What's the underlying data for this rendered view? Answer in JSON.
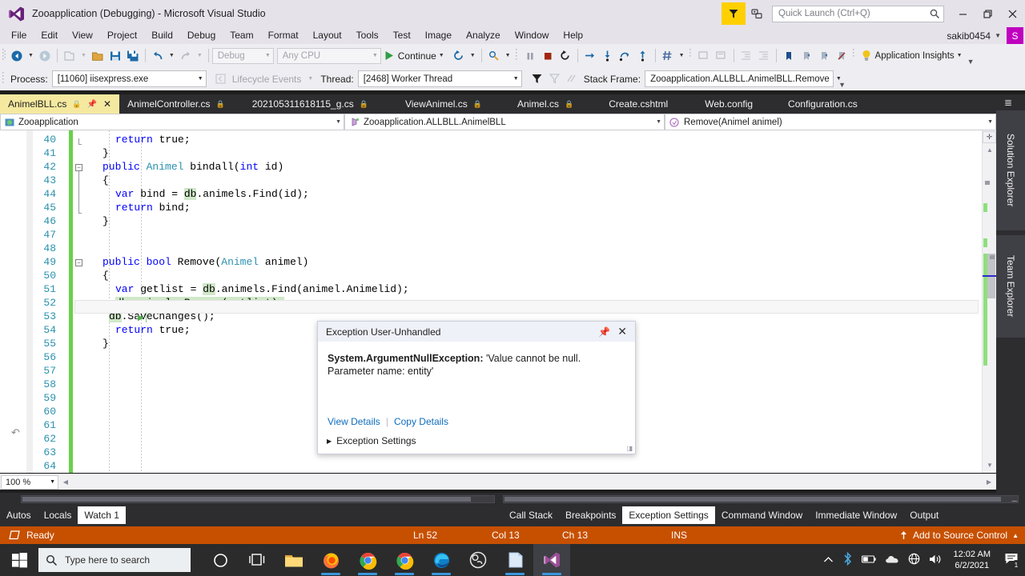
{
  "titlebar": {
    "title": "Zooapplication (Debugging) - Microsoft Visual Studio",
    "quick_launch_placeholder": "Quick Launch (Ctrl+Q)",
    "feedback_icon": "feedback-funnel-icon",
    "notify_icon": "notifications-icon",
    "search_icon": "search-icon",
    "minimize": "—",
    "restore": "❐",
    "close": "✕"
  },
  "menu": {
    "items": [
      "File",
      "Edit",
      "View",
      "Project",
      "Build",
      "Debug",
      "Team",
      "Format",
      "Layout",
      "Tools",
      "Test",
      "Image",
      "Analyze",
      "Window",
      "Help"
    ],
    "user_name": "sakib0454",
    "user_initial": "S"
  },
  "toolbar": {
    "config_value": "Debug",
    "platform_value": "Any CPU",
    "continue_label": "Continue",
    "app_insights_label": "Application Insights",
    "icons": {
      "navigate_back": "navigate-back-icon",
      "navigate_forward": "navigate-forward-icon",
      "new_project": "new-project-icon",
      "open_file": "open-file-icon",
      "save": "save-icon",
      "save_all": "save-all-icon",
      "undo": "undo-icon",
      "redo": "redo-icon",
      "attach": "attach-to-process-icon",
      "pause": "pause-icon",
      "stop": "stop-debugging-icon",
      "restart": "restart-icon",
      "show_next": "show-next-statement-icon",
      "step_into": "step-into-icon",
      "step_over": "step-over-icon",
      "step_out": "step-out-icon",
      "hash": "hash-icon",
      "bookmark": "bookmark-icon",
      "bulb": "lightbulb-icon"
    }
  },
  "debug_toolbar": {
    "process_label": "Process:",
    "process_value": "[11060] iisexpress.exe",
    "lifecycle_label": "Lifecycle Events",
    "thread_label": "Thread:",
    "thread_value": "[2468] Worker Thread",
    "stackframe_label": "Stack Frame:",
    "stackframe_value": "Zooapplication.ALLBLL.AnimelBLL.Remove",
    "filter_icon": "filter-icon"
  },
  "tabs": [
    {
      "label": "AnimelBLL.cs",
      "active": true,
      "locked": true,
      "pinnable": true,
      "closable": true
    },
    {
      "label": "AnimelController.cs",
      "active": false,
      "locked": true
    },
    {
      "label": "202105311618115_g.cs",
      "active": false,
      "locked": true
    },
    {
      "label": "ViewAnimel.cs",
      "active": false,
      "locked": true
    },
    {
      "label": "Animel.cs",
      "active": false,
      "locked": true
    },
    {
      "label": "Create.cshtml",
      "active": false,
      "locked": false
    },
    {
      "label": "Web.config",
      "active": false,
      "locked": false
    },
    {
      "label": "Configuration.cs",
      "active": false,
      "locked": false
    }
  ],
  "navbar": {
    "project": "Zooapplication",
    "type": "Zooapplication.ALLBLL.AnimelBLL",
    "member": "Remove(Animel animel)"
  },
  "editor": {
    "zoom": "100 %",
    "lines": [
      {
        "n": 40,
        "indent": 6,
        "tokens": [
          {
            "t": "return",
            "c": "kw"
          },
          {
            "t": " true;",
            "c": ""
          }
        ]
      },
      {
        "n": 41,
        "indent": 4,
        "tokens": [
          {
            "t": "}",
            "c": ""
          }
        ]
      },
      {
        "n": 42,
        "indent": 4,
        "tokens": [
          {
            "t": "public",
            "c": "kw"
          },
          {
            "t": " ",
            "c": ""
          },
          {
            "t": "Animel",
            "c": "ty"
          },
          {
            "t": " bindall(",
            "c": ""
          },
          {
            "t": "int",
            "c": "kw"
          },
          {
            "t": " id)",
            "c": ""
          }
        ]
      },
      {
        "n": 43,
        "indent": 4,
        "tokens": [
          {
            "t": "{",
            "c": ""
          }
        ]
      },
      {
        "n": 44,
        "indent": 6,
        "tokens": [
          {
            "t": "var",
            "c": "kw"
          },
          {
            "t": " bind = ",
            "c": ""
          },
          {
            "t": "db",
            "c": "hl"
          },
          {
            "t": ".animels.Find(id);",
            "c": ""
          }
        ]
      },
      {
        "n": 45,
        "indent": 6,
        "tokens": [
          {
            "t": "return",
            "c": "kw"
          },
          {
            "t": " bind;",
            "c": ""
          }
        ]
      },
      {
        "n": 46,
        "indent": 4,
        "tokens": [
          {
            "t": "}",
            "c": ""
          }
        ]
      },
      {
        "n": 47,
        "indent": 0,
        "tokens": []
      },
      {
        "n": 48,
        "indent": 0,
        "tokens": []
      },
      {
        "n": 49,
        "indent": 4,
        "tokens": [
          {
            "t": "public",
            "c": "kw"
          },
          {
            "t": " ",
            "c": ""
          },
          {
            "t": "bool",
            "c": "kw"
          },
          {
            "t": " Remove(",
            "c": ""
          },
          {
            "t": "Animel",
            "c": "ty"
          },
          {
            "t": " animel)",
            "c": ""
          }
        ]
      },
      {
        "n": 50,
        "indent": 4,
        "tokens": [
          {
            "t": "{",
            "c": ""
          }
        ]
      },
      {
        "n": 51,
        "indent": 6,
        "tokens": [
          {
            "t": "var",
            "c": "kw"
          },
          {
            "t": " getlist = ",
            "c": ""
          },
          {
            "t": "db",
            "c": "hl"
          },
          {
            "t": ".animels.Find(animel.Animelid);",
            "c": ""
          }
        ]
      },
      {
        "n": 52,
        "indent": 6,
        "tokens": [
          {
            "t": "db.animels.Remove(getlist);",
            "c": "hl"
          }
        ]
      },
      {
        "n": 53,
        "indent": 5,
        "tokens": [
          {
            "t": "db",
            "c": "hl"
          },
          {
            "t": ".SaveChanges();",
            "c": ""
          }
        ]
      },
      {
        "n": 54,
        "indent": 6,
        "tokens": [
          {
            "t": "return",
            "c": "kw"
          },
          {
            "t": " true;",
            "c": ""
          }
        ]
      },
      {
        "n": 55,
        "indent": 4,
        "tokens": [
          {
            "t": "}",
            "c": ""
          }
        ]
      },
      {
        "n": 56,
        "indent": 0,
        "tokens": []
      },
      {
        "n": 57,
        "indent": 0,
        "tokens": []
      },
      {
        "n": 58,
        "indent": 0,
        "tokens": []
      },
      {
        "n": 59,
        "indent": 0,
        "tokens": []
      },
      {
        "n": 60,
        "indent": 0,
        "tokens": []
      },
      {
        "n": 61,
        "indent": 0,
        "tokens": []
      },
      {
        "n": 62,
        "indent": 0,
        "tokens": []
      },
      {
        "n": 63,
        "indent": 0,
        "tokens": []
      },
      {
        "n": 64,
        "indent": 0,
        "tokens": []
      }
    ],
    "current_line": 52,
    "error_marker_icon": "error-circle-icon",
    "step_arrow_icon": "step-arrow-icon",
    "run-to-cursor_icon": "run-to-cursor-icon"
  },
  "exception": {
    "title": "Exception User-Unhandled",
    "type": "System.ArgumentNullException:",
    "message_line1": "'Value cannot be null.",
    "message_line2": "Parameter name: entity'",
    "view_details": "View Details",
    "copy_details": "Copy Details",
    "settings": "Exception Settings",
    "pin_icon": "pin-icon",
    "close_icon": "close-icon"
  },
  "right_dock": {
    "tabs": [
      "Solution Explorer",
      "Team Explorer"
    ]
  },
  "watch_panel": {
    "tabs": [
      {
        "label": "Autos",
        "active": false
      },
      {
        "label": "Locals",
        "active": false
      },
      {
        "label": "Watch 1",
        "active": true
      }
    ]
  },
  "output_panel": {
    "tabs": [
      {
        "label": "Call Stack",
        "active": false
      },
      {
        "label": "Breakpoints",
        "active": false
      },
      {
        "label": "Exception Settings",
        "active": true
      },
      {
        "label": "Command Window",
        "active": false
      },
      {
        "label": "Immediate Window",
        "active": false
      },
      {
        "label": "Output",
        "active": false
      }
    ]
  },
  "statusbar": {
    "state": "Ready",
    "line": "Ln 52",
    "col": "Col 13",
    "ch": "Ch 13",
    "ins": "INS",
    "source_control": "Add to Source Control",
    "upload_icon": "upload-arrow-icon",
    "caret": "▲"
  },
  "taskbar": {
    "search_placeholder": "Type here to search",
    "time": "12:02 AM",
    "date": "6/2/2021",
    "notification_count": "1",
    "icons": {
      "start": "windows-start-icon",
      "search": "search-icon",
      "cortana": "cortana-circle-icon",
      "task_view": "task-view-icon",
      "file_explorer": "file-explorer-icon",
      "firefox": "firefox-icon",
      "chrome": "chrome-icon",
      "chrome2": "chrome-icon",
      "edge": "edge-icon",
      "obs": "obs-studio-icon",
      "word": "word-icon",
      "visual_studio": "visual-studio-icon",
      "chevron_up": "chevron-up-icon",
      "bluetooth": "bluetooth-icon",
      "battery": "battery-icon",
      "onedrive": "onedrive-cloud-icon",
      "network": "network-globe-icon",
      "volume": "volume-icon",
      "action_center": "action-center-icon"
    }
  },
  "colors": {
    "vs_chrome": "#e6e2ea",
    "vs_toolbar": "#eeeef2",
    "vs_dark": "#2d2d30",
    "status_orange": "#c75000",
    "active_tab_yellow": "#f5e9a0",
    "changebar_green": "#69d14a",
    "error_red": "#d32c2c",
    "link_blue": "#0e6cbd",
    "keyword_blue": "#0000ff",
    "type_teal": "#2b91af"
  }
}
